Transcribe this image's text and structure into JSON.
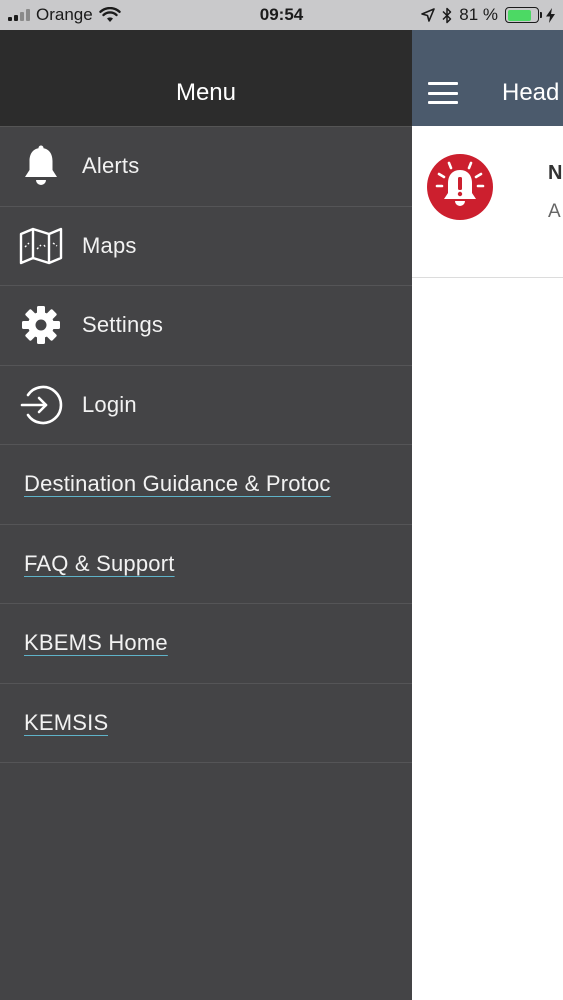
{
  "status_bar": {
    "carrier": "Orange",
    "time": "09:54",
    "battery_text": "81 %",
    "battery_level": 0.81,
    "battery_color": "#4cd964"
  },
  "drawer": {
    "title": "Menu",
    "items": [
      {
        "label": "Alerts",
        "icon": "bell-icon"
      },
      {
        "label": "Maps",
        "icon": "map-icon"
      },
      {
        "label": "Settings",
        "icon": "gear-icon"
      },
      {
        "label": "Login",
        "icon": "login-icon"
      }
    ],
    "links": [
      {
        "label": "Destination Guidance & Protoc"
      },
      {
        "label": "FAQ & Support"
      },
      {
        "label": "KBEMS Home"
      },
      {
        "label": "KEMSIS"
      }
    ],
    "background": "#444446",
    "header_background": "#2c2c2c",
    "link_underline_color": "#5fb3c9"
  },
  "main": {
    "header_title": "Head",
    "header_background": "#4b5a6c",
    "alert": {
      "title": "N",
      "subtitle": "A",
      "icon": "alarm-bell-icon",
      "icon_color": "#cc1f2e"
    }
  }
}
